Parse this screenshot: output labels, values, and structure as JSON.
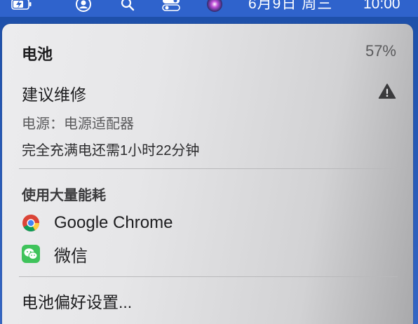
{
  "menubar": {
    "date": "6月9日 周三",
    "time": "10:00"
  },
  "battery": {
    "title": "电池",
    "percent": "57%",
    "condition": "建议维修",
    "power_source": "电源：电源适配器",
    "time_to_full": "完全充满电还需1小时22分钟"
  },
  "heavy_usage": {
    "heading": "使用大量能耗",
    "apps": [
      {
        "name": "Google Chrome",
        "icon": "chrome-icon"
      },
      {
        "name": "微信",
        "icon": "wechat-icon"
      }
    ]
  },
  "footer": {
    "prefs_label": "电池偏好设置..."
  },
  "icons": {
    "menubar": [
      "battery-charging-icon",
      "user-icon",
      "search-icon",
      "control-center-icon",
      "siri-icon"
    ],
    "warning": "warning-icon"
  },
  "colors": {
    "menubar_bg": "#2f63cc",
    "panel_bg": "#e6e6e8",
    "text_primary": "#1d1d1f",
    "text_muted": "#5a5a5c",
    "wechat_green": "#3fc35b"
  }
}
